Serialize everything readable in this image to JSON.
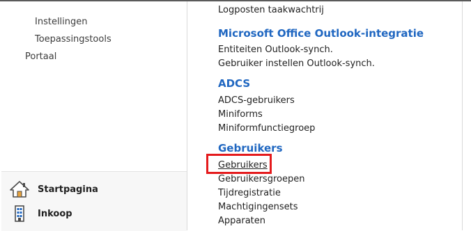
{
  "sidebar": {
    "partial_top": "...",
    "items": [
      {
        "label": "Instellingen"
      },
      {
        "label": "Toepassingstools"
      },
      {
        "label": "Portaal"
      }
    ],
    "bottom_items": [
      {
        "label": "Startpagina",
        "icon": "home-icon"
      },
      {
        "label": "Inkoop",
        "icon": "building-icon"
      }
    ]
  },
  "content": {
    "top_partial": "Logposten taakwachtrij",
    "sections": [
      {
        "title": "Microsoft Office Outlook-integratie",
        "links": [
          "Entiteiten Outlook-synch.",
          "Gebruiker instellen Outlook-synch."
        ]
      },
      {
        "title": "ADCS",
        "links": [
          "ADCS-gebruikers",
          "Miniforms",
          "Miniformfunctiegroep"
        ]
      },
      {
        "title": "Gebruikers",
        "links": [
          "Gebruikers",
          "Gebruikersgroepen",
          "Tijdregistratie",
          "Machtigingensets",
          "Apparaten"
        ]
      }
    ]
  },
  "colors": {
    "group_heading": "#2067c1",
    "highlight": "#e41a1c",
    "text": "#1f1f1f"
  }
}
